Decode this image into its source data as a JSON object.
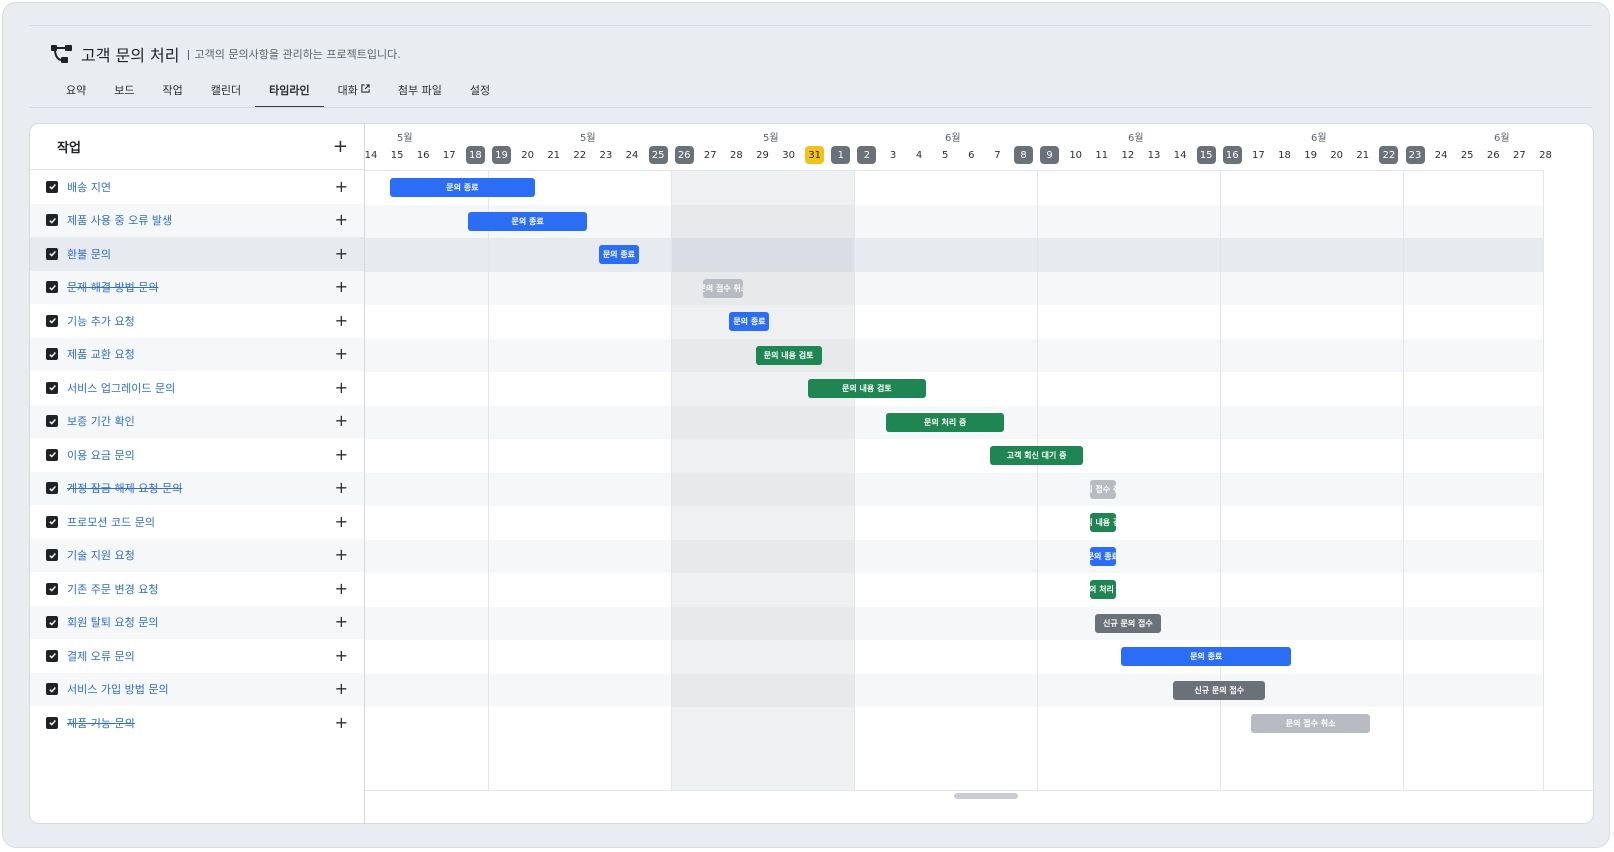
{
  "project": {
    "title": "고객 문의 처리",
    "description": "고객의 문의사항을 관리하는 프로젝트입니다.",
    "icon": "workflow-icon"
  },
  "tabs": [
    {
      "label": "요약",
      "active": false
    },
    {
      "label": "보드",
      "active": false
    },
    {
      "label": "작업",
      "active": false
    },
    {
      "label": "캘린더",
      "active": false
    },
    {
      "label": "타임라인",
      "active": true
    },
    {
      "label": "대화",
      "active": false,
      "external": true
    },
    {
      "label": "첨부 파일",
      "active": false
    },
    {
      "label": "설정",
      "active": false
    }
  ],
  "left_panel": {
    "title": "작업",
    "add_icon": "plus-icon"
  },
  "months": [
    "5월",
    "5월",
    "5월",
    "6월",
    "6월",
    "6월",
    "6월"
  ],
  "days": [
    {
      "d": "14",
      "kind": "normal"
    },
    {
      "d": "15",
      "kind": "normal"
    },
    {
      "d": "16",
      "kind": "normal"
    },
    {
      "d": "17",
      "kind": "normal"
    },
    {
      "d": "18",
      "kind": "weekend"
    },
    {
      "d": "19",
      "kind": "weekend"
    },
    {
      "d": "20",
      "kind": "normal"
    },
    {
      "d": "21",
      "kind": "normal"
    },
    {
      "d": "22",
      "kind": "normal"
    },
    {
      "d": "23",
      "kind": "normal"
    },
    {
      "d": "24",
      "kind": "normal"
    },
    {
      "d": "25",
      "kind": "weekend"
    },
    {
      "d": "26",
      "kind": "weekend"
    },
    {
      "d": "27",
      "kind": "normal"
    },
    {
      "d": "28",
      "kind": "normal"
    },
    {
      "d": "29",
      "kind": "normal"
    },
    {
      "d": "30",
      "kind": "normal"
    },
    {
      "d": "31",
      "kind": "today"
    },
    {
      "d": "1",
      "kind": "weekend"
    },
    {
      "d": "2",
      "kind": "weekend"
    },
    {
      "d": "3",
      "kind": "normal"
    },
    {
      "d": "4",
      "kind": "normal"
    },
    {
      "d": "5",
      "kind": "normal"
    },
    {
      "d": "6",
      "kind": "normal"
    },
    {
      "d": "7",
      "kind": "normal"
    },
    {
      "d": "8",
      "kind": "weekend"
    },
    {
      "d": "9",
      "kind": "weekend"
    },
    {
      "d": "10",
      "kind": "normal"
    },
    {
      "d": "11",
      "kind": "normal"
    },
    {
      "d": "12",
      "kind": "normal"
    },
    {
      "d": "13",
      "kind": "normal"
    },
    {
      "d": "14",
      "kind": "normal"
    },
    {
      "d": "15",
      "kind": "weekend"
    },
    {
      "d": "16",
      "kind": "weekend"
    },
    {
      "d": "17",
      "kind": "normal"
    },
    {
      "d": "18",
      "kind": "normal"
    },
    {
      "d": "19",
      "kind": "normal"
    },
    {
      "d": "20",
      "kind": "normal"
    },
    {
      "d": "21",
      "kind": "normal"
    },
    {
      "d": "22",
      "kind": "weekend"
    },
    {
      "d": "23",
      "kind": "weekend"
    },
    {
      "d": "24",
      "kind": "normal"
    },
    {
      "d": "25",
      "kind": "normal"
    },
    {
      "d": "26",
      "kind": "normal"
    },
    {
      "d": "27",
      "kind": "normal"
    },
    {
      "d": "28",
      "kind": "normal"
    }
  ],
  "tasks": [
    {
      "name": "배송 지연",
      "strike": false,
      "bar": {
        "label": "문의 종료",
        "start": "05-15",
        "end": "05-20",
        "status": "closed"
      }
    },
    {
      "name": "제품 사용 중 오류 발생",
      "strike": false,
      "bar": {
        "label": "문의 종료",
        "start": "05-18",
        "end": "05-22",
        "status": "closed"
      }
    },
    {
      "name": "환불 문의",
      "strike": false,
      "bar": {
        "label": "문의 종료",
        "start": "05-23",
        "end": "05-24",
        "status": "closed"
      }
    },
    {
      "name": "문제 해결 방법 문의",
      "strike": true,
      "bar": {
        "label": "문의 접수 취소",
        "start": "05-27",
        "end": "05-28",
        "status": "cancelled"
      }
    },
    {
      "name": "기능 추가 요청",
      "strike": false,
      "bar": {
        "label": "문의 종료",
        "start": "05-28",
        "end": "05-29",
        "status": "closed"
      }
    },
    {
      "name": "제품 교환 요청",
      "strike": false,
      "bar": {
        "label": "문의 내용 검토",
        "start": "05-29",
        "end": "05-31",
        "status": "in-progress"
      }
    },
    {
      "name": "서비스 업그레이드 문의",
      "strike": false,
      "bar": {
        "label": "문의 내용 검토",
        "start": "05-31",
        "end": "06-04",
        "status": "in-progress"
      }
    },
    {
      "name": "보증 기간 확인",
      "strike": false,
      "bar": {
        "label": "문의 처리 중",
        "start": "06-03",
        "end": "06-07",
        "status": "in-progress"
      }
    },
    {
      "name": "이용 요금 문의",
      "strike": false,
      "bar": {
        "label": "고객 회신 대기 중",
        "start": "06-07",
        "end": "06-10",
        "status": "in-progress"
      }
    },
    {
      "name": "계정 잠금 해제 요청 문의",
      "strike": true,
      "bar": {
        "label": "문의 접수 취소",
        "start": "06-11",
        "end": "06-11",
        "status": "cancelled"
      }
    },
    {
      "name": "프로모션 코드 문의",
      "strike": false,
      "bar": {
        "label": "문의 내용 검토",
        "start": "06-11",
        "end": "06-11",
        "status": "in-progress"
      }
    },
    {
      "name": "기술 지원 요청",
      "strike": false,
      "bar": {
        "label": "문의 종료",
        "start": "06-11",
        "end": "06-11",
        "status": "closed"
      }
    },
    {
      "name": "기존 주문 변경 요청",
      "strike": false,
      "bar": {
        "label": "문의 처리 중",
        "start": "06-11",
        "end": "06-11",
        "status": "in-progress"
      }
    },
    {
      "name": "회원 탈퇴 요청 문의",
      "strike": false,
      "bar": {
        "label": "신규 문의 접수",
        "start": "06-11",
        "end": "06-13",
        "status": "new"
      }
    },
    {
      "name": "결제 오류 문의",
      "strike": false,
      "bar": {
        "label": "문의 종료",
        "start": "06-12",
        "end": "06-18",
        "status": "closed"
      }
    },
    {
      "name": "서비스 가입 방법 문의",
      "strike": false,
      "bar": {
        "label": "신규 문의 접수",
        "start": "06-14",
        "end": "06-17",
        "status": "new"
      }
    },
    {
      "name": "제품 기능 문의",
      "strike": true,
      "bar": {
        "label": "문의 접수 취소",
        "start": "06-17",
        "end": "06-21",
        "status": "cancelled"
      }
    }
  ],
  "status_colors": {
    "closed": "#2b6ef5",
    "in-progress": "#1f8553",
    "new": "#6b7178",
    "cancelled": "#b8bcc2"
  },
  "highlighted_row": 2
}
